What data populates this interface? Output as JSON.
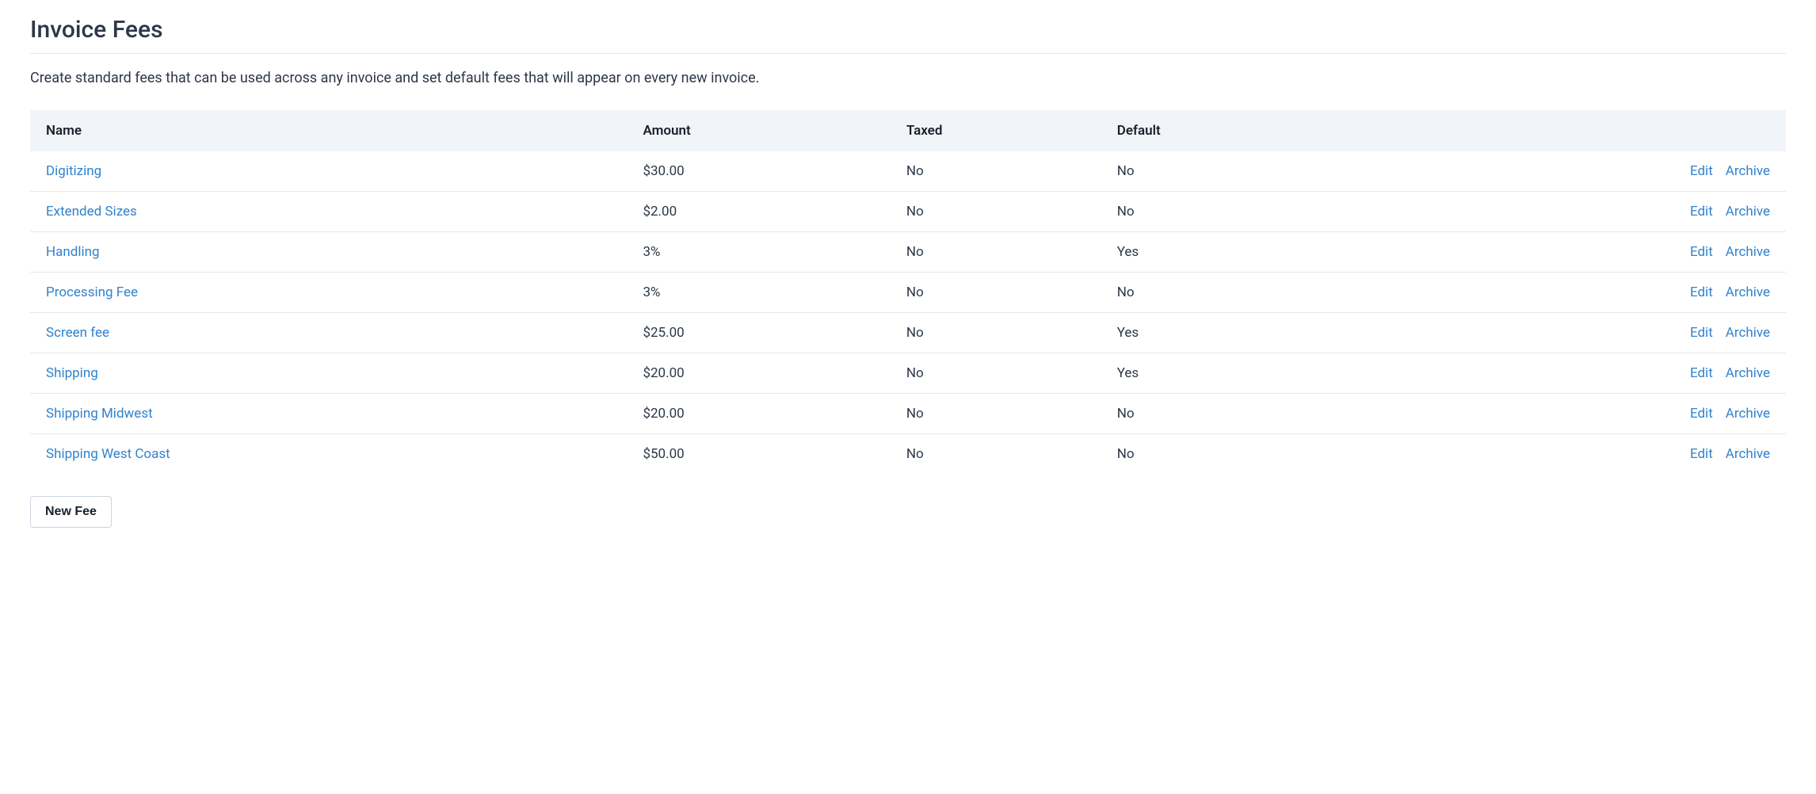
{
  "header": {
    "title": "Invoice Fees",
    "description": "Create standard fees that can be used across any invoice and set default fees that will appear on every new invoice."
  },
  "table": {
    "columns": {
      "name": "Name",
      "amount": "Amount",
      "taxed": "Taxed",
      "default": "Default"
    },
    "actions": {
      "edit": "Edit",
      "archive": "Archive"
    },
    "rows": [
      {
        "name": "Digitizing",
        "amount": "$30.00",
        "taxed": "No",
        "default": "No"
      },
      {
        "name": "Extended Sizes",
        "amount": "$2.00",
        "taxed": "No",
        "default": "No"
      },
      {
        "name": "Handling",
        "amount": "3%",
        "taxed": "No",
        "default": "Yes"
      },
      {
        "name": "Processing Fee",
        "amount": "3%",
        "taxed": "No",
        "default": "No"
      },
      {
        "name": "Screen fee",
        "amount": "$25.00",
        "taxed": "No",
        "default": "Yes"
      },
      {
        "name": "Shipping",
        "amount": "$20.00",
        "taxed": "No",
        "default": "Yes"
      },
      {
        "name": "Shipping Midwest",
        "amount": "$20.00",
        "taxed": "No",
        "default": "No"
      },
      {
        "name": "Shipping West Coast",
        "amount": "$50.00",
        "taxed": "No",
        "default": "No"
      }
    ]
  },
  "buttons": {
    "new_fee": "New Fee"
  }
}
